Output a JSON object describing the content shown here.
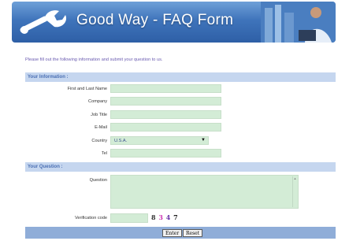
{
  "header": {
    "title": "Good Way - FAQ Form",
    "logo_icon": "wrench-icon"
  },
  "intro_text": "Please fill out the following information and submit your question to us.",
  "section_info": {
    "title": "Your Information :"
  },
  "fields": {
    "name_label": "First and Last Name",
    "company_label": "Company",
    "job_title_label": "Job Title",
    "email_label": "E-Mail",
    "country_label": "Country",
    "country_value": "U.S.A.",
    "tel_label": "Tel"
  },
  "section_question": {
    "title": "Your Question :"
  },
  "question_label": "Question",
  "verification": {
    "label": "Verification code",
    "code_chars": [
      {
        "ch": "8",
        "color": "#333333"
      },
      {
        "ch": "3",
        "color": "#cc2fb0"
      },
      {
        "ch": "4",
        "color": "#6a34a8"
      },
      {
        "ch": "7",
        "color": "#1a1a1a"
      }
    ]
  },
  "buttons": {
    "enter": "Enter",
    "reset": "Reset"
  },
  "colors": {
    "field_bg": "#d3ecd6",
    "section_bg": "#c5d6ef",
    "footer_bg": "#8fadd8"
  }
}
